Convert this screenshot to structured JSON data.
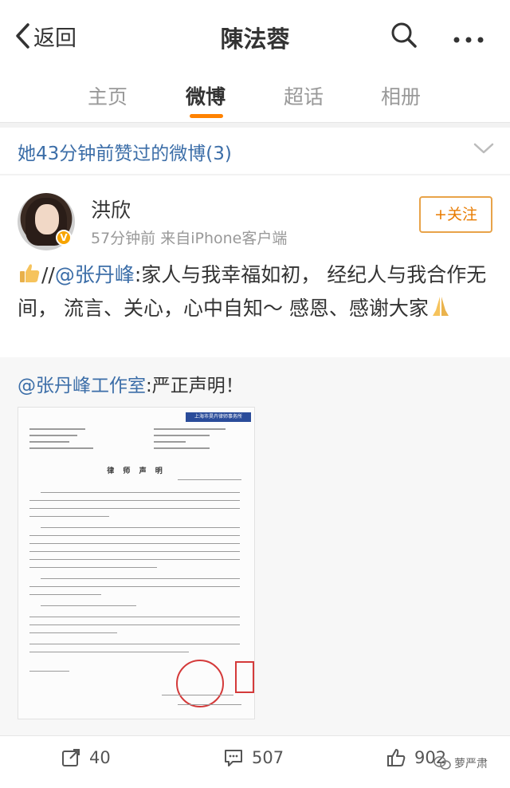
{
  "nav": {
    "back_label": "返回",
    "title": "陳法蓉"
  },
  "tabs": [
    {
      "label": "主页"
    },
    {
      "label": "微博"
    },
    {
      "label": "超话"
    },
    {
      "label": "相册"
    }
  ],
  "liked_bar": {
    "text": "她43分钟前赞过的微博(3)"
  },
  "post": {
    "username": "洪欣",
    "meta": "57分钟前 来自iPhone客户端",
    "follow_label": "+关注",
    "text_prefix": "//",
    "mention": "@张丹峰",
    "text": ":家人与我幸福如初， 经纪人与我合作无间， 流言、关心，心中自知～ 感恩、感谢大家",
    "repost": {
      "mention": "@张丹峰工作室",
      "text": ":严正声明！",
      "doc_banner": "上海市昊卉律师事务所",
      "doc_title": "律 师 声 明"
    }
  },
  "actions": {
    "repost_count": "40",
    "comment_count": "507",
    "like_count": "902"
  },
  "watermark": "萝严肃"
}
